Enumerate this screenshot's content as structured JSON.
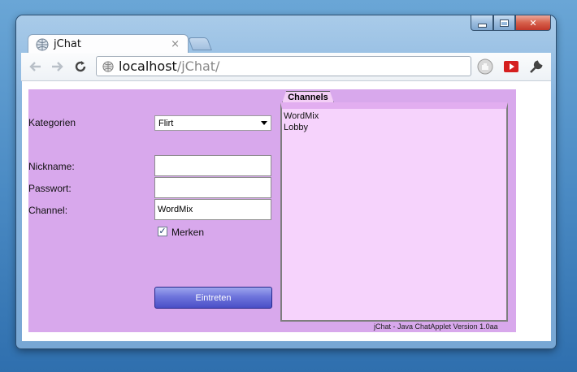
{
  "browser": {
    "tab_title": "jChat",
    "tab_close": "×",
    "url_host": "localhost",
    "url_path": "/jChat/",
    "icons": [
      "back-icon",
      "forward-icon",
      "reload-icon",
      "globe-icon",
      "stop-icon",
      "youtube-icon",
      "wrench-icon"
    ]
  },
  "window": {
    "minimize": "",
    "maximize": "",
    "close": "✕"
  },
  "form": {
    "kategorien_label": "Kategorien",
    "kategorien_value": "Flirt",
    "nickname_label": "Nickname:",
    "nickname_value": "",
    "passwort_label": "Passwort:",
    "passwort_value": "",
    "channel_label": "Channel:",
    "channel_value": "WordMix",
    "merken_label": "Merken",
    "merken_checked": true,
    "submit_label": "Eintreten"
  },
  "channels": {
    "tab_label": "Channels",
    "items": [
      "WordMix",
      "Lobby"
    ]
  },
  "footer": "jChat - Java ChatApplet Version 1.0aa",
  "colors": {
    "applet_bg": "#d8a8ec",
    "panel_bg": "#f6d3fc",
    "button": "#6e74dc"
  }
}
